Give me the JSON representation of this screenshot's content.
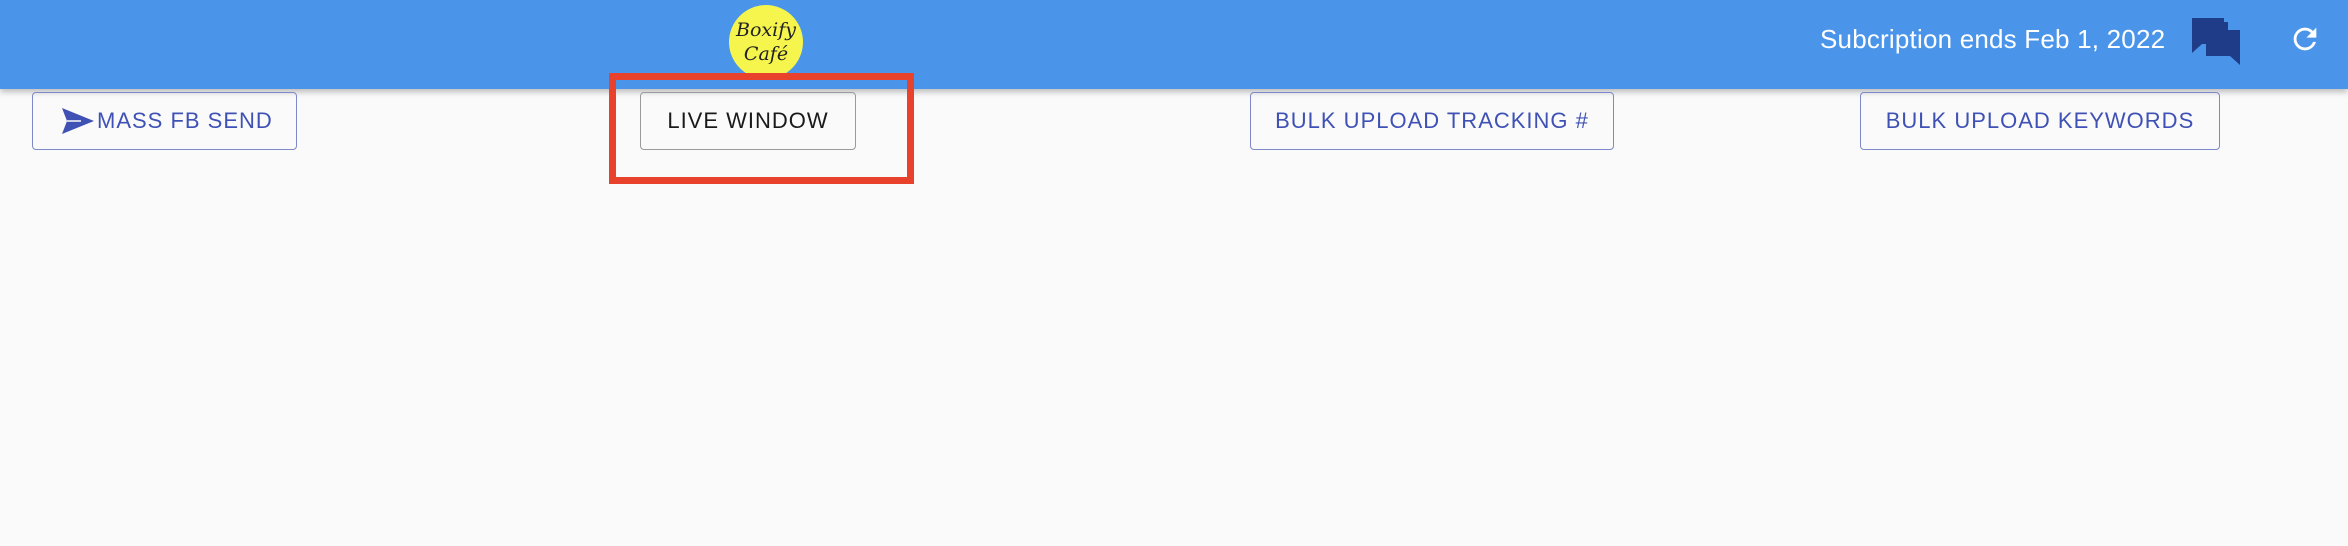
{
  "header": {
    "logo_line1": "Boxify",
    "logo_line2": "Café",
    "subscription_text": "Subcription ends Feb 1, 2022",
    "chat_icon": "chat-bubbles-icon",
    "refresh_icon": "refresh-icon"
  },
  "toolbar": {
    "mass_fb_send_label": "MASS FB SEND",
    "mass_fb_send_icon": "send-icon",
    "live_window_label": "LIVE WINDOW",
    "bulk_tracking_label": "BULK UPLOAD TRACKING #",
    "bulk_keywords_label": "BULK UPLOAD KEYWORDS"
  },
  "colors": {
    "appbar": "#4a95ea",
    "logo_bg": "#f5f54d",
    "button_text": "#3f51b5",
    "highlight": "#e8412c",
    "chat_icon": "#1f3c88"
  }
}
